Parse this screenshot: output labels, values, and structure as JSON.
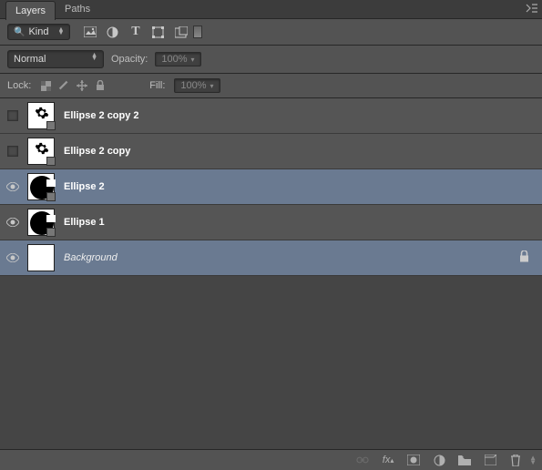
{
  "tabs": {
    "layers": "Layers",
    "paths": "Paths"
  },
  "filter": {
    "kind_label": "Kind"
  },
  "blend": {
    "mode": "Normal",
    "opacity_label": "Opacity:",
    "opacity_value": "100%"
  },
  "lock": {
    "label": "Lock:",
    "fill_label": "Fill:",
    "fill_value": "100%"
  },
  "layers": [
    {
      "name": "Ellipse 2 copy 2",
      "visible": false,
      "selected": false,
      "locked": false,
      "thumb": "gear"
    },
    {
      "name": "Ellipse 2 copy",
      "visible": false,
      "selected": false,
      "locked": false,
      "thumb": "gear"
    },
    {
      "name": "Ellipse 2",
      "visible": true,
      "selected": true,
      "locked": false,
      "thumb": "ellipse"
    },
    {
      "name": "Ellipse 1",
      "visible": true,
      "selected": false,
      "locked": false,
      "thumb": "ellipse"
    },
    {
      "name": "Background",
      "visible": true,
      "selected": true,
      "locked": true,
      "thumb": "white",
      "italic": true
    }
  ],
  "icons": {
    "search": "search-icon",
    "image": "image-icon",
    "adjust": "adjust-icon",
    "type": "type-icon",
    "shape": "shape-icon",
    "smart": "smartobject-icon",
    "link": "link-icon",
    "fx": "fx-icon",
    "mask": "mask-icon",
    "newfill": "newfill-icon",
    "group": "group-icon",
    "new": "newlayer-icon",
    "trash": "trash-icon"
  }
}
